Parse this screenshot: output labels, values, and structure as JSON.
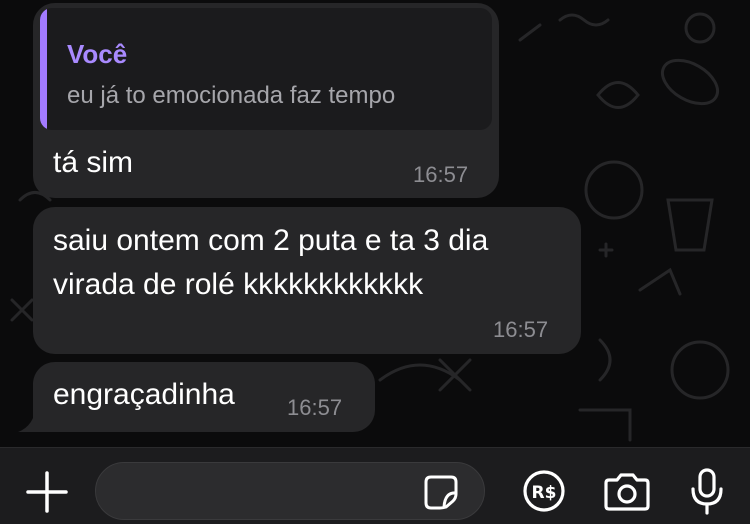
{
  "messages": [
    {
      "reply_to": {
        "author": "Você",
        "text": "eu já to emocionada faz tempo"
      },
      "text": "tá sim",
      "time": "16:57"
    },
    {
      "text_lines": [
        "saiu ontem com 2 puta e ta 3 dia",
        "virada de rolé kkkkkkkkkkkk"
      ],
      "time": "16:57"
    },
    {
      "text": "engraçadinha",
      "time": "16:57"
    }
  ],
  "composer": {
    "placeholder": "",
    "icons": [
      "plus-icon",
      "sticker-icon",
      "pix-payment-icon",
      "camera-icon",
      "microphone-icon"
    ]
  },
  "colors": {
    "background": "#0b0b0c",
    "bubble": "#262628",
    "quote_accent": "#a37bff",
    "timestamp": "#8d8d92"
  }
}
